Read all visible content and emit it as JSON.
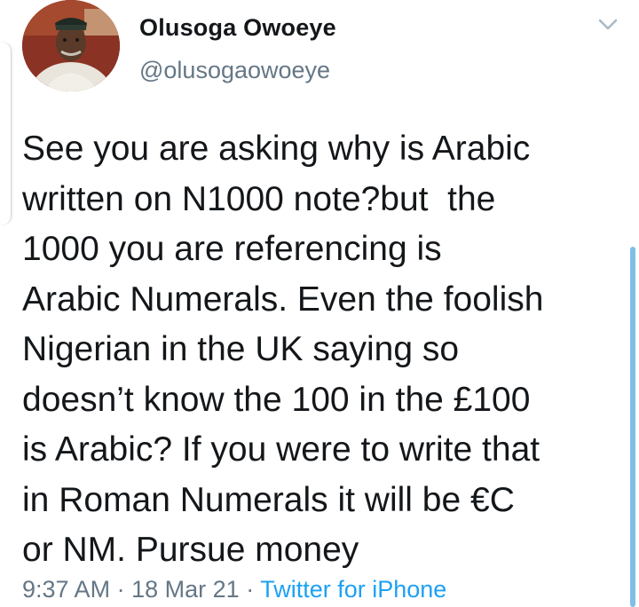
{
  "tweet": {
    "author": {
      "name": "Olusoga Owoeye",
      "handle": "@olusogaowoeye",
      "avatar_icon": "user-avatar"
    },
    "menu_icon": "chevron-down-icon",
    "text": "See you are asking why is Arabic\nwritten on N1000 note?but  the\n1000 you are referencing is\nArabic Numerals. Even the foolish\nNigerian in the UK saying so\ndoesn’t know the 100 in the £100\nis Arabic? If you were to write that\nin Roman Numerals it will be €C\nor NM. Pursue money",
    "time": "9:37 AM",
    "separator": "·",
    "date": "18 Mar 21",
    "source": "Twitter for iPhone"
  },
  "colors": {
    "text_primary": "#14171a",
    "text_secondary": "#657786",
    "link": "#1da1f2",
    "scrollbar": "#7fbfe6"
  }
}
